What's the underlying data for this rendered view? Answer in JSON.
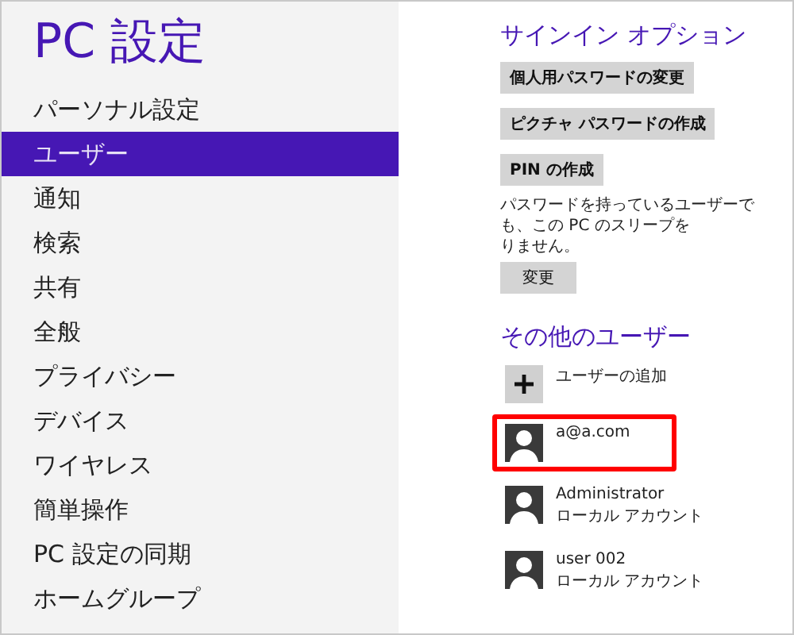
{
  "sidebar": {
    "title": "PC 設定",
    "items": [
      {
        "label": "パーソナル設定",
        "selected": false
      },
      {
        "label": "ユーザー",
        "selected": true
      },
      {
        "label": "通知",
        "selected": false
      },
      {
        "label": "検索",
        "selected": false
      },
      {
        "label": "共有",
        "selected": false
      },
      {
        "label": "全般",
        "selected": false
      },
      {
        "label": "プライバシー",
        "selected": false
      },
      {
        "label": "デバイス",
        "selected": false
      },
      {
        "label": "ワイヤレス",
        "selected": false
      },
      {
        "label": "簡単操作",
        "selected": false
      },
      {
        "label": "PC 設定の同期",
        "selected": false
      },
      {
        "label": "ホームグループ",
        "selected": false
      }
    ]
  },
  "content": {
    "signin": {
      "heading": "サインイン オプション",
      "buttons": [
        "個人用パスワードの変更",
        "ピクチャ パスワードの作成",
        "PIN の作成"
      ],
      "note_lines": [
        "パスワードを持っているユーザーでも、この PC のスリープを",
        "りません。"
      ],
      "change_button": "変更"
    },
    "other_users": {
      "heading": "その他のユーザー",
      "add_label": "ユーザーの追加",
      "users": [
        {
          "name": "a@a.com",
          "highlighted": true
        },
        {
          "name": "Administrator",
          "type": "ローカル アカウント",
          "highlighted": false
        },
        {
          "name": "user 002",
          "type": "ローカル アカウント",
          "highlighted": false
        }
      ]
    }
  }
}
